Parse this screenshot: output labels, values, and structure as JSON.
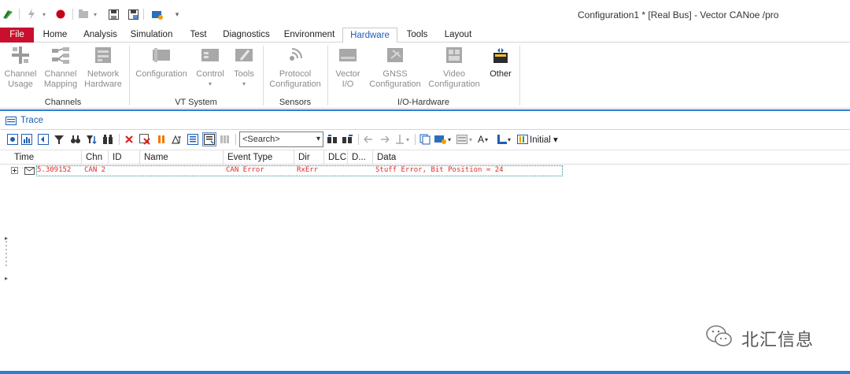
{
  "window": {
    "title": "Configuration1 * [Real Bus] - Vector CANoe /pro"
  },
  "ribbon_tabs": [
    {
      "label": "File"
    },
    {
      "label": "Home"
    },
    {
      "label": "Analysis"
    },
    {
      "label": "Simulation"
    },
    {
      "label": "Test"
    },
    {
      "label": "Diagnostics"
    },
    {
      "label": "Environment"
    },
    {
      "label": "Hardware"
    },
    {
      "label": "Tools"
    },
    {
      "label": "Layout"
    }
  ],
  "active_tab": "Hardware",
  "ribbon": {
    "buttons": [
      {
        "line1": "Channel",
        "line2": "Usage",
        "icon": "channel-usage-icon"
      },
      {
        "line1": "Channel",
        "line2": "Mapping",
        "icon": "channel-mapping-icon"
      },
      {
        "line1": "Network",
        "line2": "Hardware",
        "icon": "network-hardware-icon"
      },
      {
        "line1": "Configuration",
        "line2": "",
        "icon": "vt-configuration-icon"
      },
      {
        "line1": "Control",
        "line2": "▾",
        "icon": "vt-control-icon"
      },
      {
        "line1": "Tools",
        "line2": "▾",
        "icon": "vt-tools-icon"
      },
      {
        "line1": "Protocol",
        "line2": "Configuration",
        "icon": "protocol-configuration-icon"
      },
      {
        "line1": "Vector",
        "line2": "I/O",
        "icon": "vector-io-icon"
      },
      {
        "line1": "GNSS",
        "line2": "Configuration",
        "icon": "gnss-configuration-icon"
      },
      {
        "line1": "Video",
        "line2": "Configuration",
        "icon": "video-configuration-icon"
      },
      {
        "line1": "Other",
        "line2": "",
        "icon": "other-icon"
      }
    ],
    "groups": [
      {
        "label": "Channels"
      },
      {
        "label": "VT System"
      },
      {
        "label": "Sensors"
      },
      {
        "label": "I/O-Hardware"
      }
    ]
  },
  "trace": {
    "title": "Trace",
    "search_placeholder": "<Search>",
    "view_label": "Initial ▾",
    "columns": [
      "Time",
      "Chn",
      "ID",
      "Name",
      "Event Type",
      "Dir",
      "DLC",
      "D...",
      "Data"
    ],
    "rows": [
      {
        "time": "5.309152",
        "chn": "CAN 2",
        "id": "",
        "name": "",
        "event_type": "CAN Error",
        "dir": "RxErr",
        "dlc": "",
        "d": "",
        "data": "Stuff Error, Bit Position = 24"
      }
    ]
  },
  "watermark": {
    "text": "北汇信息"
  },
  "colors": {
    "file_tab": "#c8102e",
    "accent": "#2a7fd4",
    "error_text": "#e22a2a",
    "active_tab_text": "#1e5fb4"
  }
}
